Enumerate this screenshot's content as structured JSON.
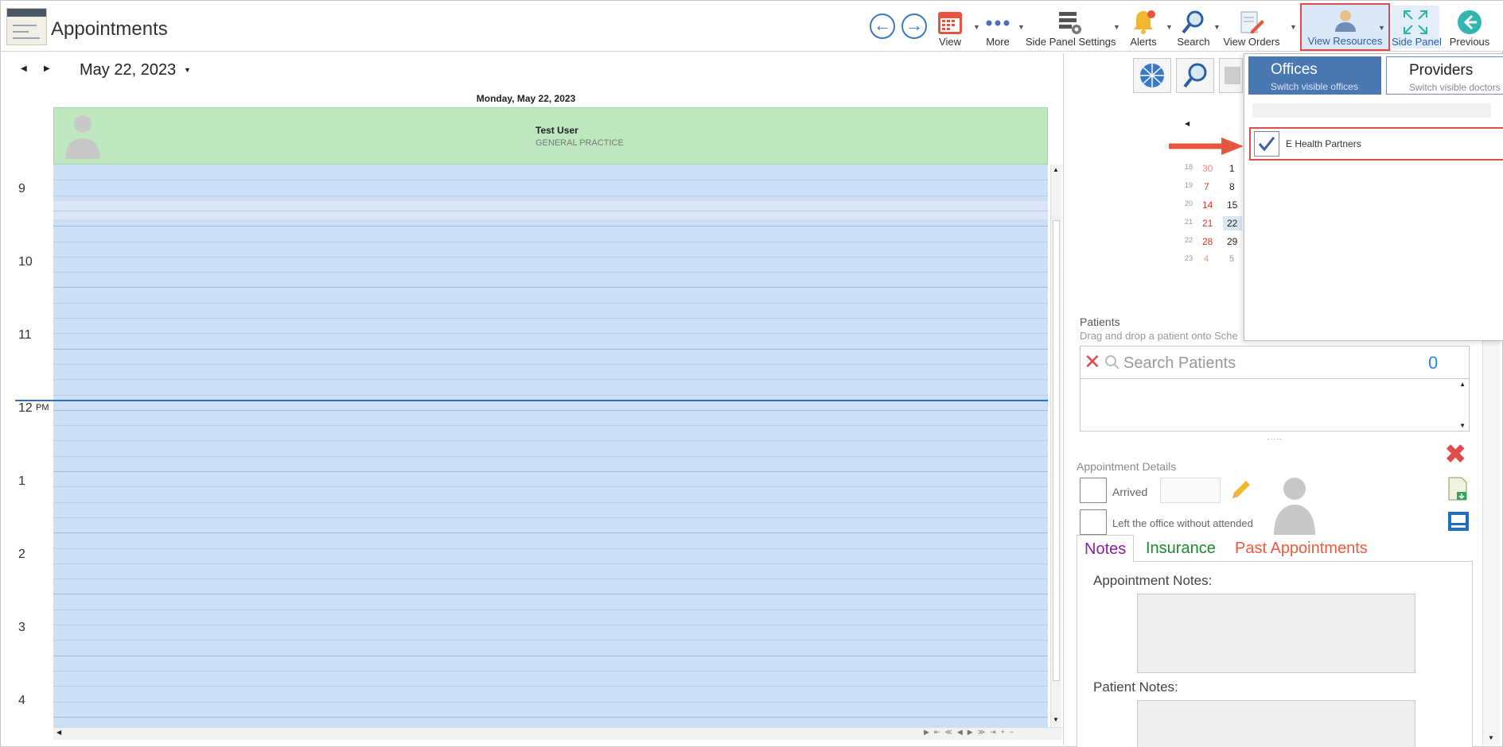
{
  "header": {
    "title": "Appointments",
    "toolbar": [
      {
        "label": "View",
        "icon": "calendar-icon"
      },
      {
        "label": "More",
        "icon": "more-dots-icon"
      },
      {
        "label": "Side Panel Settings",
        "icon": "side-panel-settings-icon"
      },
      {
        "label": "Alerts",
        "icon": "bell-icon"
      },
      {
        "label": "Search",
        "icon": "magnifier-icon"
      },
      {
        "label": "View Orders",
        "icon": "orders-pencil-icon"
      },
      {
        "label": "View Resources",
        "icon": "resources-person-icon"
      },
      {
        "label": "Side Panel",
        "icon": "expand-arrows-icon"
      },
      {
        "label": "Previous",
        "icon": "back-arrow-icon"
      }
    ]
  },
  "calendar": {
    "date": "May 22, 2023",
    "day_header": "Monday, May 22, 2023",
    "resource_name": "Test User",
    "resource_specialty": "GENERAL PRACTICE",
    "hours": [
      "9",
      "10",
      "11",
      "12",
      "1",
      "2",
      "3",
      "4"
    ],
    "pm_label": "PM"
  },
  "mini_calendar": {
    "rows": [
      {
        "week": "18",
        "a": "30",
        "b": "1"
      },
      {
        "week": "19",
        "a": "7",
        "b": "8"
      },
      {
        "week": "20",
        "a": "14",
        "b": "15"
      },
      {
        "week": "21",
        "a": "21",
        "b": "22"
      },
      {
        "week": "22",
        "a": "28",
        "b": "29"
      },
      {
        "week": "23",
        "a": "4",
        "b": "5"
      }
    ]
  },
  "patients": {
    "title": "Patients",
    "hint": "Drag and drop a patient onto Sche",
    "search_placeholder": "Search Patients",
    "count": "0"
  },
  "appointment_details": {
    "title": "Appointment Details",
    "arrived_label": "Arrived",
    "left_label": "Left the office without attended",
    "tabs": [
      "Notes",
      "Insurance",
      "Past Appointments"
    ],
    "appointment_notes_label": "Appointment Notes:",
    "patient_notes_label": "Patient Notes:"
  },
  "resources_dropdown": {
    "offices_title": "Offices",
    "offices_sub": "Switch visible offices",
    "providers_title": "Providers",
    "providers_sub": "Switch visible doctors",
    "office_item": "E Health Partners",
    "office_checked": true
  },
  "colors": {
    "resource_header": "#bde8bf",
    "grid": "#cddff4",
    "now_line": "#2c6fc7",
    "highlight": "#e04b4b",
    "offices_tab": "#4a78b3"
  }
}
